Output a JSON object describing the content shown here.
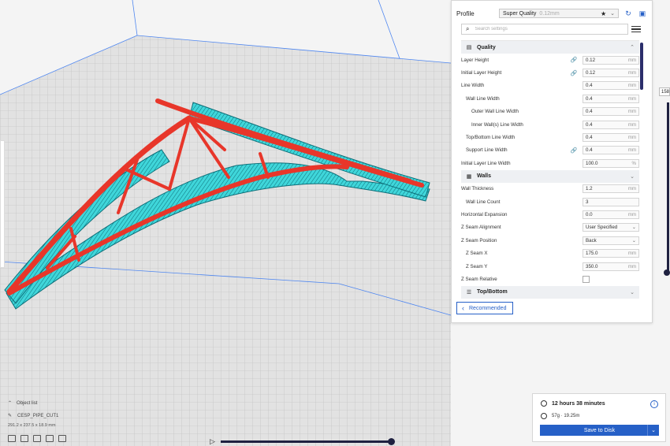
{
  "colors": {
    "accent": "#2660c7",
    "build_plate": "#e2e2e2",
    "grid_line": "#c6c6c6",
    "support": "#3fd6da",
    "model": "#e8362a",
    "slider": "#1f2140"
  },
  "profile": {
    "label": "Profile",
    "name": "Super Quality",
    "sub": "0.12mm",
    "star_icon": "star-icon",
    "reset_icon": "undo-icon",
    "save_icon": "save-icon"
  },
  "search": {
    "placeholder": "Search settings"
  },
  "settings": {
    "quality": {
      "title": "Quality",
      "rows": [
        {
          "label": "Layer Height",
          "value": "0.12",
          "unit": "mm",
          "link": true
        },
        {
          "label": "Initial Layer Height",
          "value": "0.12",
          "unit": "mm",
          "link": true
        },
        {
          "label": "Line Width",
          "value": "0.4",
          "unit": "mm"
        },
        {
          "label": "Wall Line Width",
          "value": "0.4",
          "unit": "mm"
        },
        {
          "label": "Outer Wall Line Width",
          "value": "0.4",
          "unit": "mm"
        },
        {
          "label": "Inner Wall(s) Line Width",
          "value": "0.4",
          "unit": "mm"
        },
        {
          "label": "Top/Bottom Line Width",
          "value": "0.4",
          "unit": "mm"
        },
        {
          "label": "Support Line Width",
          "value": "0.4",
          "unit": "mm",
          "link": true
        },
        {
          "label": "Initial Layer Line Width",
          "value": "100.0",
          "unit": "%"
        }
      ]
    },
    "walls": {
      "title": "Walls",
      "rows": [
        {
          "label": "Wall Thickness",
          "value": "1.2",
          "unit": "mm"
        },
        {
          "label": "Wall Line Count",
          "value": "3",
          "unit": ""
        },
        {
          "label": "Horizontal Expansion",
          "value": "0.0",
          "unit": "mm"
        },
        {
          "label": "Z Seam Alignment",
          "value": "User Specified",
          "unit": "select"
        },
        {
          "label": "Z Seam Position",
          "value": "Back",
          "unit": "select"
        },
        {
          "label": "Z Seam X",
          "value": "175.0",
          "unit": "mm"
        },
        {
          "label": "Z Seam Y",
          "value": "350.0",
          "unit": "mm"
        },
        {
          "label": "Z Seam Relative",
          "value": "",
          "unit": "checkbox"
        }
      ]
    },
    "topbottom": {
      "title": "Top/Bottom"
    }
  },
  "recommended_label": "Recommended",
  "layer_slider": {
    "value": "158"
  },
  "object_list": {
    "title": "Object list",
    "object_name": "CESP_PIPE_CUT1",
    "dimensions": "291.2 x 237.5 x 18.9 mm"
  },
  "print_info": {
    "time": "12 hours 38 minutes",
    "material": "57g · 19.25m",
    "save_label": "Save to Disk"
  }
}
